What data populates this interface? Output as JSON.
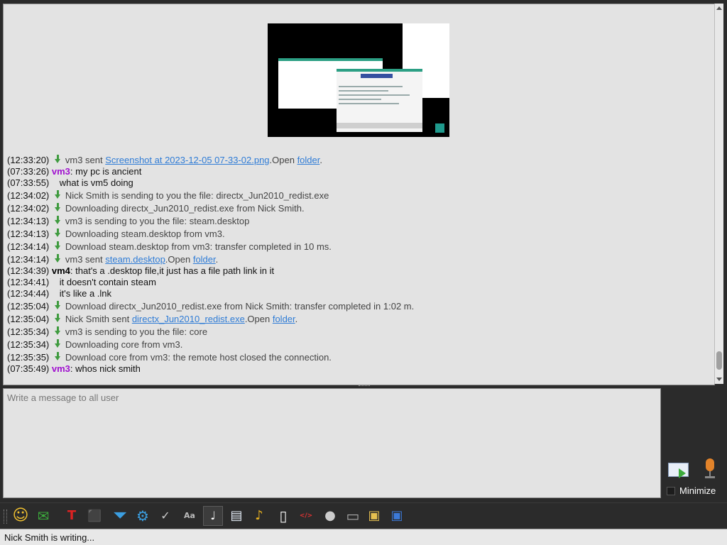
{
  "chat": {
    "messages": [
      {
        "time": "(12:33:20)",
        "icon": "download-icon",
        "text": "vm3 sent ",
        "link": "Screenshot at 2023-12-05 07-33-02.png",
        "after": ".Open ",
        "link2": "folder",
        "tail": "."
      },
      {
        "time": "(07:33:26)",
        "sender": "vm3",
        "text": ": my pc is ancient"
      },
      {
        "time": "(07:33:55)",
        "text": "what is vm5 doing"
      },
      {
        "time": "(12:34:02)",
        "icon": "download-icon",
        "text": "Nick Smith is sending to you the file: directx_Jun2010_redist.exe"
      },
      {
        "time": "(12:34:02)",
        "icon": "download-icon",
        "text": "Downloading directx_Jun2010_redist.exe from Nick Smith."
      },
      {
        "time": "(12:34:13)",
        "icon": "download-icon",
        "text": "vm3 is sending to you the file: steam.desktop"
      },
      {
        "time": "(12:34:13)",
        "icon": "download-icon",
        "text": "Downloading steam.desktop from vm3."
      },
      {
        "time": "(12:34:14)",
        "icon": "download-icon",
        "text": "Download steam.desktop from vm3: transfer completed in 10 ms."
      },
      {
        "time": "(12:34:14)",
        "icon": "download-icon",
        "text": "vm3 sent ",
        "link": "steam.desktop",
        "after": ".Open ",
        "link2": "folder",
        "tail": "."
      },
      {
        "time": "(12:34:39)",
        "sender": "vm4",
        "text": ": that's a .desktop file,it just has a file path link in it"
      },
      {
        "time": "(12:34:41)",
        "text": "it doesn't contain steam"
      },
      {
        "time": "(12:34:44)",
        "text": "it's like a .lnk"
      },
      {
        "time": "(12:35:04)",
        "icon": "download-icon",
        "text": "Download directx_Jun2010_redist.exe from Nick Smith: transfer completed in 1:02 m."
      },
      {
        "time": "(12:35:04)",
        "icon": "download-icon",
        "text": "Nick Smith sent ",
        "link": "directx_Jun2010_redist.exe",
        "after": ".Open ",
        "link2": "folder",
        "tail": "."
      },
      {
        "time": "(12:35:34)",
        "icon": "download-icon",
        "text": "vm3 is sending to you the file: core"
      },
      {
        "time": "(12:35:34)",
        "icon": "download-icon",
        "text": "Downloading core from vm3."
      },
      {
        "time": "(12:35:35)",
        "icon": "download-icon",
        "text": "Download core from vm3: the remote host closed the connection."
      },
      {
        "time": "(07:35:49)",
        "sender": "vm3",
        "text": ": whos nick smith"
      }
    ]
  },
  "colors": {
    "vm3": "#a010d0",
    "vm4": "#000000",
    "link": "#2f7cd6"
  },
  "input": {
    "placeholder": "Write a message to all user"
  },
  "controls": {
    "minimize_label": "Minimize"
  },
  "toolbar": {
    "icons": [
      "smiley-icon",
      "envelope-icon",
      "text-color-icon",
      "background-color-icon",
      "filter-icon",
      "settings-gear-icon",
      "spellcheck-icon",
      "font-icon",
      "note-icon",
      "send-file-icon",
      "send-music-icon",
      "document-icon",
      "html-code-icon",
      "record-icon",
      "screenshot-icon",
      "clipboard-icon",
      "save-icon"
    ]
  },
  "status": {
    "text": "Nick Smith is writing..."
  }
}
